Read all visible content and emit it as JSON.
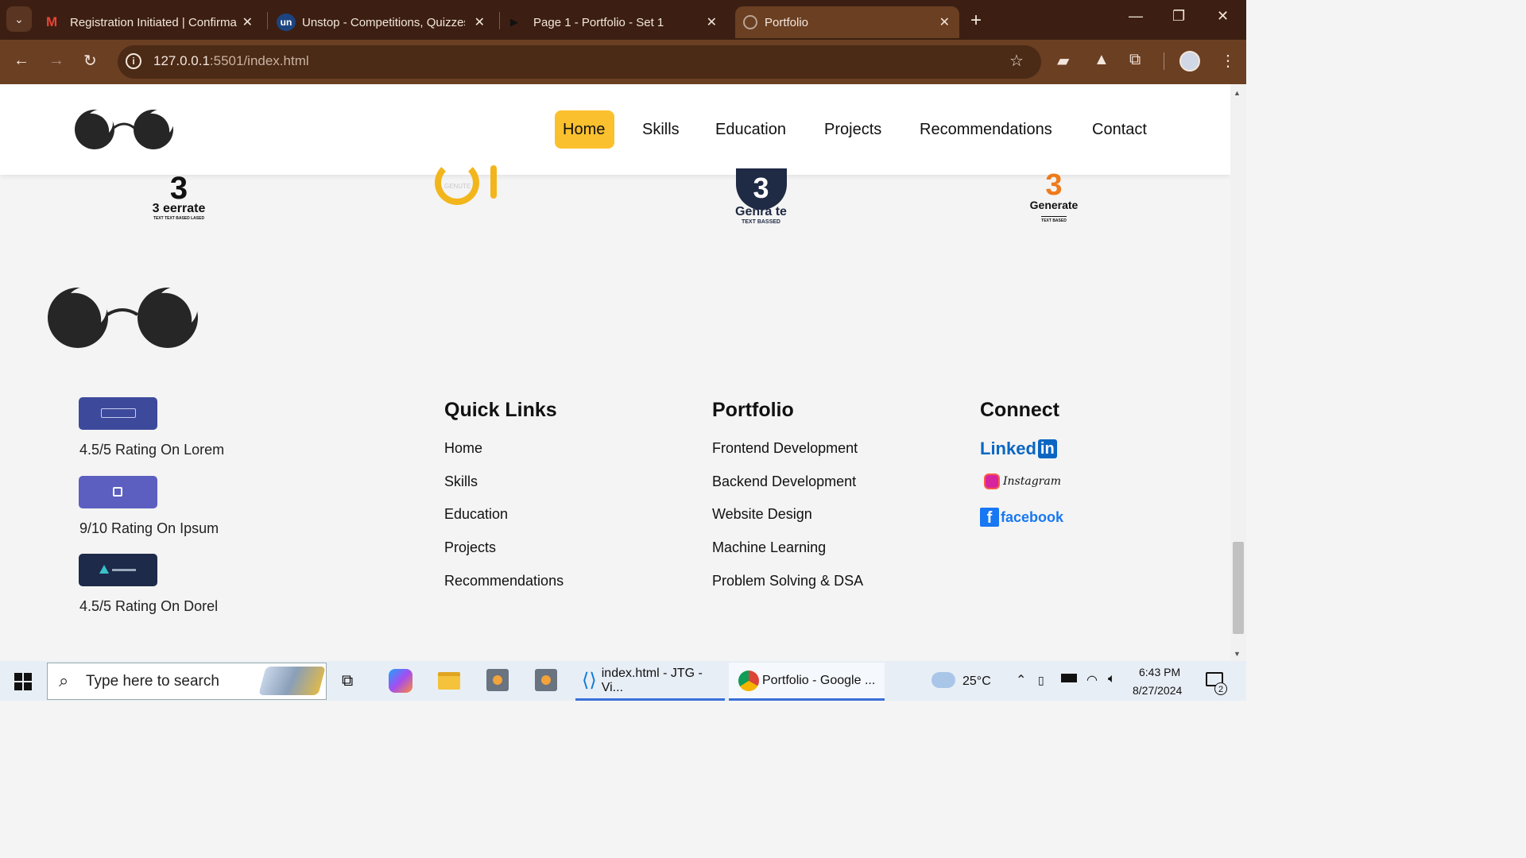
{
  "browser": {
    "tabs": [
      {
        "title": "Registration Initiated | Confirma",
        "icon": "gmail-icon"
      },
      {
        "title": "Unstop - Competitions, Quizzes",
        "icon": "unstop-icon"
      },
      {
        "title": "Page 1 - Portfolio - Set 1",
        "icon": "play-icon"
      },
      {
        "title": "Portfolio",
        "icon": "globe-icon",
        "active": true
      }
    ],
    "url_host": "127.0.0.1",
    "url_rest": ":5501/index.html"
  },
  "nav": {
    "items": [
      "Home",
      "Skills",
      "Education",
      "Projects",
      "Recommendations",
      "Contact"
    ],
    "active": "Home"
  },
  "brands": [
    {
      "name": "3 eerrate",
      "tag": "TEXT TEXT BASED LASED"
    },
    {
      "name": "GENUTE",
      "tag": ""
    },
    {
      "name": "Genra te",
      "tag": "TEXT BASSED"
    },
    {
      "name": "Generate",
      "tag": "TEXT BASED"
    }
  ],
  "ratings": [
    {
      "text": "4.5/5 Rating On Lorem",
      "badge_color": "#3d4a9c"
    },
    {
      "text": "9/10 Rating On Ipsum",
      "badge_color": "#5c5fc0"
    },
    {
      "text": "4.5/5 Rating On Dorel",
      "badge_color": "#1e2a4a"
    }
  ],
  "quick_links": {
    "title": "Quick Links",
    "items": [
      "Home",
      "Skills",
      "Education",
      "Projects",
      "Recommendations"
    ]
  },
  "portfolio": {
    "title": "Portfolio",
    "items": [
      "Frontend Development",
      "Backend Development",
      "Website Design",
      "Machine Learning",
      "Problem Solving & DSA"
    ]
  },
  "connect": {
    "title": "Connect",
    "items": [
      "Linked",
      "in",
      "Instagram",
      "facebook"
    ]
  },
  "taskbar": {
    "search_placeholder": "Type here to search",
    "apps": [
      "index.html - JTG - Vi...",
      "Portfolio - Google ..."
    ],
    "weather": "25°C",
    "time": "6:43 PM",
    "date": "8/27/2024",
    "notifications": "2"
  },
  "colors": {
    "accent": "#fbc02d",
    "linkedin": "#0a66c2",
    "facebook": "#1877f2"
  }
}
